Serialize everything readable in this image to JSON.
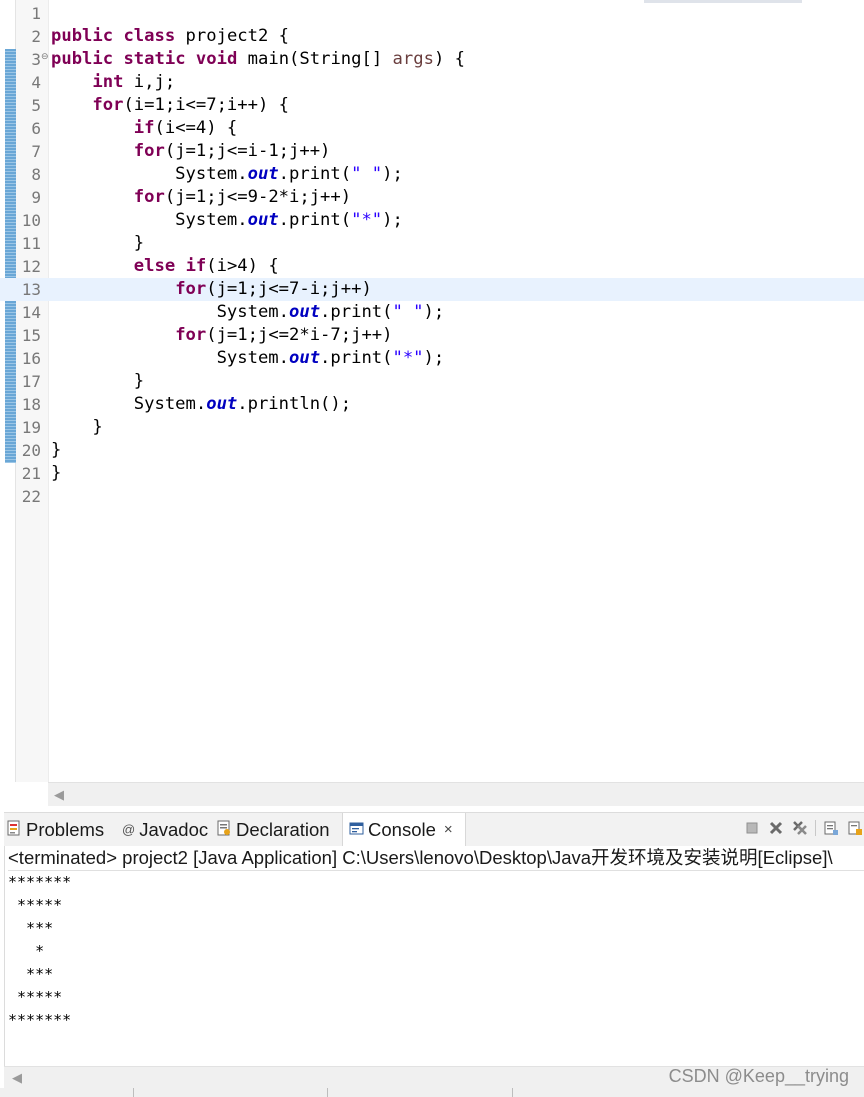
{
  "editor": {
    "lines": [
      {
        "n": "1",
        "segs": []
      },
      {
        "n": "2",
        "segs": [
          [
            "kw",
            "public"
          ],
          [
            "t",
            " "
          ],
          [
            "kw",
            "class"
          ],
          [
            "t",
            " project2 {"
          ]
        ]
      },
      {
        "n": "3",
        "fold": "⊖",
        "segs": [
          [
            "kw",
            "public"
          ],
          [
            "t",
            " "
          ],
          [
            "kw",
            "static"
          ],
          [
            "t",
            " "
          ],
          [
            "kw",
            "void"
          ],
          [
            "t",
            " main(String[] "
          ],
          [
            "arg",
            "args"
          ],
          [
            "t",
            ") {"
          ]
        ]
      },
      {
        "n": "4",
        "segs": [
          [
            "t",
            "    "
          ],
          [
            "kw",
            "int"
          ],
          [
            "t",
            " i,j;"
          ]
        ]
      },
      {
        "n": "5",
        "segs": [
          [
            "t",
            "    "
          ],
          [
            "kw",
            "for"
          ],
          [
            "t",
            "(i=1;i<=7;i++) {"
          ]
        ]
      },
      {
        "n": "6",
        "segs": [
          [
            "t",
            "        "
          ],
          [
            "kw",
            "if"
          ],
          [
            "t",
            "(i<=4) {"
          ]
        ]
      },
      {
        "n": "7",
        "segs": [
          [
            "t",
            "        "
          ],
          [
            "kw",
            "for"
          ],
          [
            "t",
            "(j=1;j<=i-1;j++)"
          ]
        ]
      },
      {
        "n": "8",
        "segs": [
          [
            "t",
            "            System."
          ],
          [
            "fld",
            "out"
          ],
          [
            "t",
            ".print("
          ],
          [
            "str",
            "\" \""
          ],
          [
            "t",
            ");"
          ]
        ]
      },
      {
        "n": "9",
        "segs": [
          [
            "t",
            "        "
          ],
          [
            "kw",
            "for"
          ],
          [
            "t",
            "(j=1;j<=9-2*i;j++)"
          ]
        ]
      },
      {
        "n": "10",
        "segs": [
          [
            "t",
            "            System."
          ],
          [
            "fld",
            "out"
          ],
          [
            "t",
            ".print("
          ],
          [
            "str",
            "\"*\""
          ],
          [
            "t",
            ");"
          ]
        ]
      },
      {
        "n": "11",
        "segs": [
          [
            "t",
            "        }"
          ]
        ]
      },
      {
        "n": "12",
        "segs": [
          [
            "t",
            "        "
          ],
          [
            "kw",
            "else"
          ],
          [
            "t",
            " "
          ],
          [
            "kw",
            "if"
          ],
          [
            "t",
            "(i>4) {"
          ]
        ]
      },
      {
        "n": "13",
        "current": true,
        "segs": [
          [
            "t",
            "            "
          ],
          [
            "kw",
            "for"
          ],
          [
            "t",
            "(j=1;j<=7-i;j++)"
          ]
        ]
      },
      {
        "n": "14",
        "segs": [
          [
            "t",
            "                System."
          ],
          [
            "fld",
            "out"
          ],
          [
            "t",
            ".print("
          ],
          [
            "str",
            "\" \""
          ],
          [
            "t",
            ");"
          ]
        ]
      },
      {
        "n": "15",
        "segs": [
          [
            "t",
            "            "
          ],
          [
            "kw",
            "for"
          ],
          [
            "t",
            "(j=1;j<=2*i-7;j++)"
          ]
        ]
      },
      {
        "n": "16",
        "segs": [
          [
            "t",
            "                System."
          ],
          [
            "fld",
            "out"
          ],
          [
            "t",
            ".print("
          ],
          [
            "str",
            "\"*\""
          ],
          [
            "t",
            ");"
          ]
        ]
      },
      {
        "n": "17",
        "segs": [
          [
            "t",
            "        }"
          ]
        ]
      },
      {
        "n": "18",
        "segs": [
          [
            "t",
            "        System."
          ],
          [
            "fld",
            "out"
          ],
          [
            "t",
            ".println();"
          ]
        ]
      },
      {
        "n": "19",
        "segs": [
          [
            "t",
            "    }"
          ]
        ]
      },
      {
        "n": "20",
        "segs": [
          [
            "t",
            "}"
          ]
        ]
      },
      {
        "n": "21",
        "segs": [
          [
            "t",
            "}"
          ]
        ]
      },
      {
        "n": "22",
        "segs": []
      }
    ]
  },
  "views": {
    "tabs": [
      {
        "id": "problems",
        "label": "Problems",
        "icon": "problems-icon"
      },
      {
        "id": "javadoc",
        "label": "Javadoc",
        "icon": "javadoc-icon"
      },
      {
        "id": "declaration",
        "label": "Declaration",
        "icon": "declaration-icon"
      },
      {
        "id": "console",
        "label": "Console",
        "icon": "console-icon",
        "active": true,
        "close": "×"
      }
    ],
    "toolbar": [
      "terminate-icon",
      "remove-launch-icon",
      "remove-all-terminated-icon",
      "pin-console-icon",
      "display-console-icon"
    ]
  },
  "console": {
    "header": "<terminated> project2 [Java Application] C:\\Users\\lenovo\\Desktop\\Java开发环境及安装说明[Eclipse]\\",
    "output": [
      "*******",
      " *****",
      "  ***",
      "   *",
      "  ***",
      " *****",
      "*******"
    ]
  },
  "watermark": "CSDN @Keep__trying",
  "colors": {
    "keyword": "#7f0055",
    "string": "#2a00ff",
    "static_field": "#0000c0",
    "parameter": "#6a3e3e",
    "current_line": "#e8f2fe",
    "change_bar": "#6aa7d6"
  }
}
